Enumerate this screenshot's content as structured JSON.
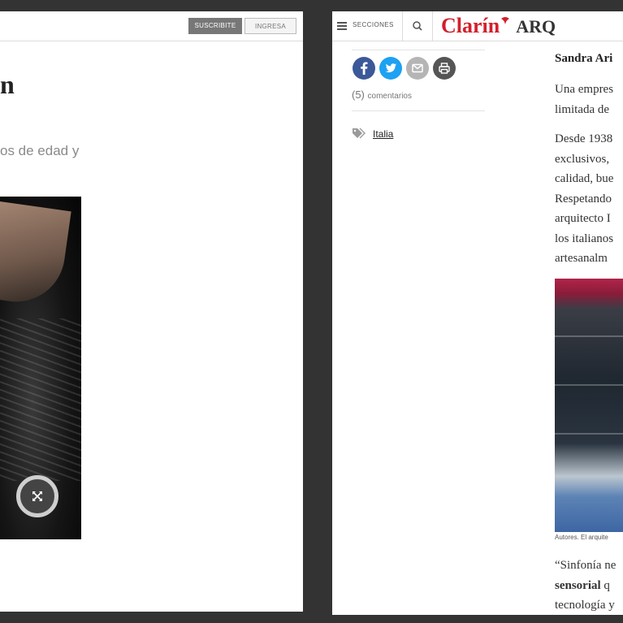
{
  "left_window": {
    "header": {
      "subscribe_label": "SUSCRIBITE",
      "login_label": "INGRESA"
    },
    "headline": "n",
    "subtitle": "os de edad y",
    "expand_icon": "expand-arrows-icon"
  },
  "right_window": {
    "header": {
      "menu_label": "SECCIONES",
      "menu_icon": "hamburger-icon",
      "search_icon": "search-icon",
      "brand": "Clarín",
      "section": "ARQ",
      "brand_color": "#d1202c"
    },
    "share": {
      "icons": [
        "facebook-icon",
        "twitter-icon",
        "email-icon",
        "print-icon"
      ],
      "colors": [
        "#3b5998",
        "#1da1f2",
        "#b5b5b5",
        "#555555"
      ]
    },
    "comments": {
      "count": "(5)",
      "label": "comentarios"
    },
    "tag": {
      "icon": "tag-icon",
      "label": "Italia"
    },
    "article": {
      "author": "Sandra Ari",
      "p1_lines": [
        "Una empres",
        "limitada de"
      ],
      "p2_lines": [
        "Desde 1938",
        "exclusivos,",
        "calidad, bue",
        "Respetando",
        "arquitecto I",
        "los italianos",
        "artesanalm"
      ],
      "caption": "Autores. El arquite",
      "p3_line1": "“Sinfonía ne",
      "p3_line2_bold": "sensorial",
      "p3_line2_rest": " q",
      "p3_line3": "tecnología y"
    }
  }
}
